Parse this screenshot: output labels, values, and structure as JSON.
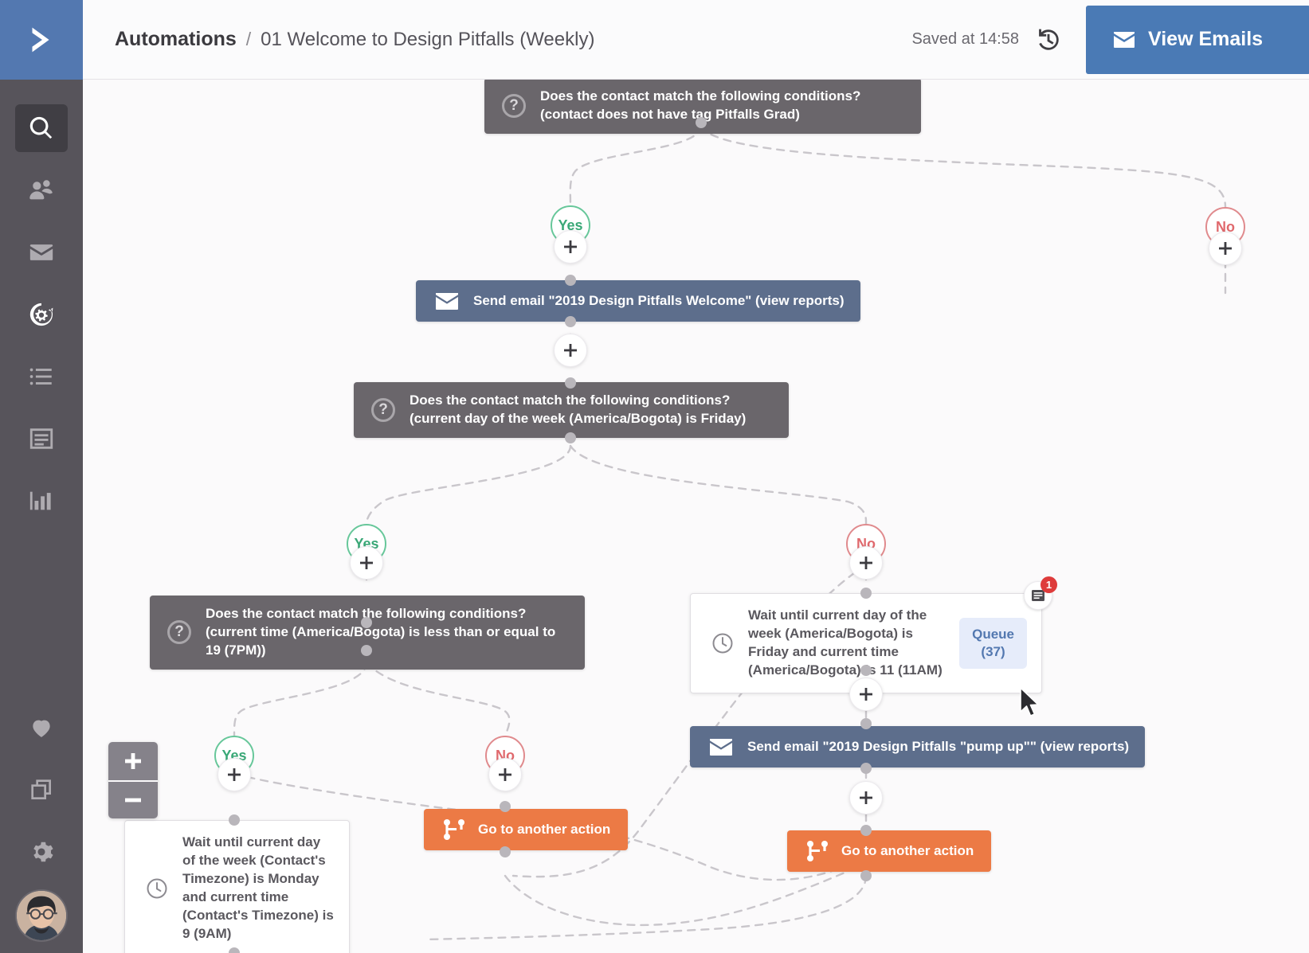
{
  "app": {
    "brand_icon": "chevron-right-logo",
    "accent_blue": "#4a7ab5",
    "sidebar_bg": "#57545b"
  },
  "sidebar": {
    "items": [
      {
        "name": "search",
        "icon": "search-icon",
        "active": true
      },
      {
        "name": "contacts",
        "icon": "contacts-icon",
        "active": false
      },
      {
        "name": "campaigns",
        "icon": "envelope-icon",
        "active": false
      },
      {
        "name": "automations",
        "icon": "automations-gear-icon",
        "active": true
      },
      {
        "name": "lists",
        "icon": "list-icon",
        "active": false
      },
      {
        "name": "forms",
        "icon": "form-icon",
        "active": false
      },
      {
        "name": "reports",
        "icon": "bar-chart-icon",
        "active": false
      }
    ],
    "bottom_items": [
      {
        "name": "deals",
        "icon": "heart-icon"
      },
      {
        "name": "apps",
        "icon": "copy-icon"
      },
      {
        "name": "settings",
        "icon": "gear-icon"
      }
    ],
    "avatar": "user-avatar"
  },
  "header": {
    "breadcrumb_root": "Automations",
    "breadcrumb_separator": "/",
    "breadcrumb_current": "01 Welcome to Design Pitfalls (Weekly)",
    "saved_at": "Saved at 14:58",
    "history_icon": "history-clock-icon",
    "view_emails_label": "View Emails",
    "view_emails_icon": "envelope-icon"
  },
  "canvas": {
    "zoom_in_label": "+",
    "zoom_out_label": "−",
    "nodes": {
      "cond_tag": {
        "type": "condition",
        "icon": "question-mark-icon",
        "text": "Does the contact match the following conditions? (contact does not have tag Pitfalls Grad)"
      },
      "email_welcome": {
        "type": "email",
        "icon": "envelope-icon",
        "text": "Send email \"2019 Design Pitfalls Welcome\" (view reports)"
      },
      "cond_friday": {
        "type": "condition",
        "icon": "question-mark-icon",
        "text": "Does the contact match the following conditions? (current day of the week (America/Bogota) is Friday)"
      },
      "cond_time": {
        "type": "condition",
        "icon": "question-mark-icon",
        "text": "Does the contact match the following conditions? (current time (America/Bogota) is less than or equal to 19 (7PM))"
      },
      "wait_friday": {
        "type": "wait",
        "icon": "clock-icon",
        "text": "Wait until current day of the week (America/Bogota) is Friday and current time (America/Bogota) is 11 (11AM)",
        "queue_label": "Queue",
        "queue_count": "(37)",
        "note_icon": "note-icon",
        "note_count": "1"
      },
      "email_pumpup": {
        "type": "email",
        "icon": "envelope-icon",
        "text": "Send email \"2019 Design Pitfalls \"pump up\"\" (view reports)"
      },
      "goto_left": {
        "type": "goto",
        "icon": "branch-icon",
        "text": "Go to another action"
      },
      "goto_right": {
        "type": "goto",
        "icon": "branch-icon",
        "text": "Go to another action"
      },
      "wait_monday": {
        "type": "wait",
        "icon": "clock-icon",
        "text": "Wait until current day of the week (Contact's Timezone) is Monday and current time (Contact's Timezone) is 9 (9AM)"
      }
    },
    "branches": {
      "b1_yes": "Yes",
      "b1_no": "No",
      "b2_yes": "Yes",
      "b2_no": "No",
      "b3_yes": "Yes",
      "b3_no": "No"
    },
    "plus_label": "+"
  }
}
